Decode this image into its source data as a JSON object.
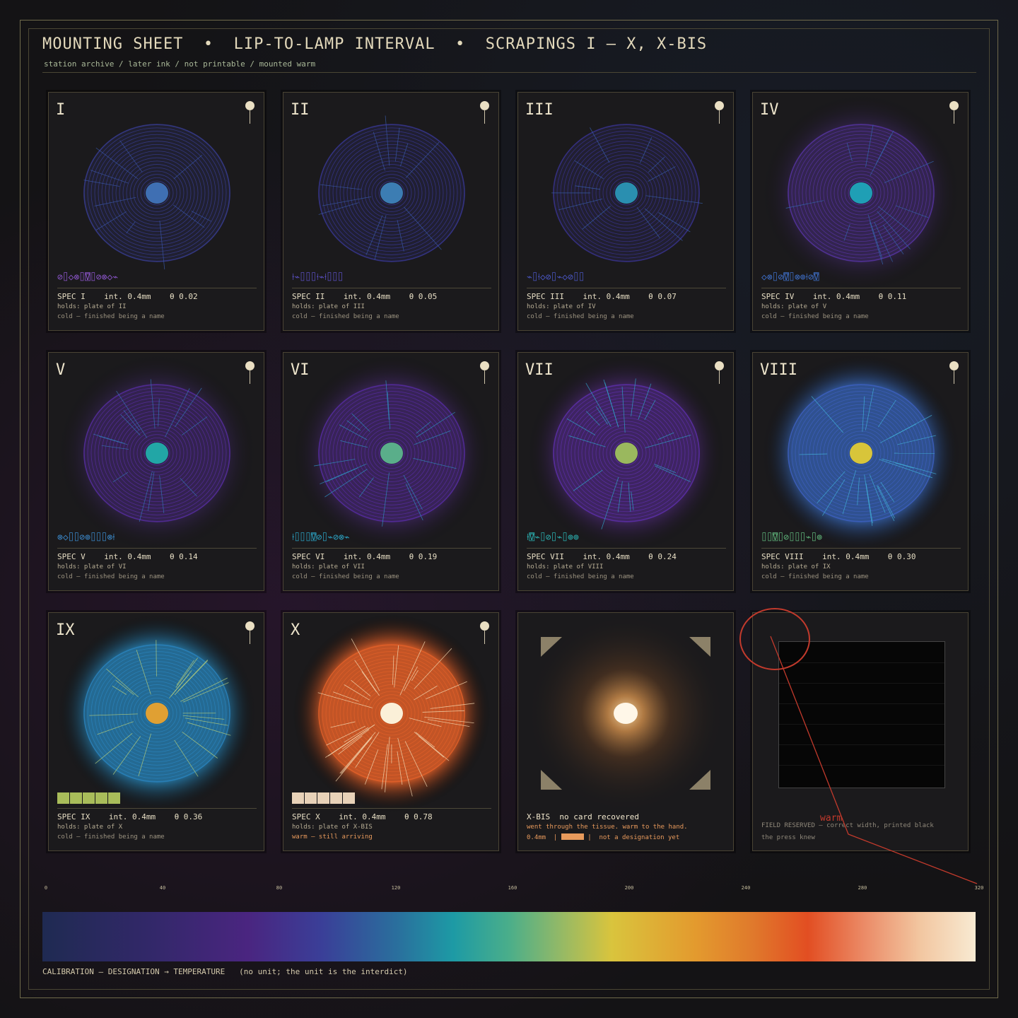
{
  "header": {
    "title": "MOUNTING SHEET  •  LIP-TO-LAMP INTERVAL  •  SCRAPINGS I — X, X-BIS",
    "subtitle": "station archive / later ink / not printable / mounted warm"
  },
  "cards": [
    {
      "numeral": "I",
      "glyphs": "⊘⌷◇⊗⌷⍔⌷⊘⊗◇⌁",
      "glyph_color": "#8b55c9",
      "spec": "SPEC I    int. 0.4mm    θ 0.02",
      "holds": "holds: plate of II",
      "state": "cold — finished being a name",
      "ring": "#3a3f98",
      "core": "#3f6fb3",
      "ray": "#3a56a8",
      "glow": "rgba(40,40,110,0.0)",
      "theta": 0.02,
      "interval_mm": 0.4
    },
    {
      "numeral": "II",
      "glyphs": "⍿⌁⌷⌷⌷⍿⌁⍿⌷⌷⌷",
      "glyph_color": "#5a4fc0",
      "spec": "SPEC II    int. 0.4mm    θ 0.05",
      "holds": "holds: plate of III",
      "state": "cold — finished being a name",
      "ring": "#3a3a9a",
      "core": "#3c7db3",
      "ray": "#3a5aa8",
      "glow": "rgba(40,40,110,0.0)",
      "theta": 0.05,
      "interval_mm": 0.4
    },
    {
      "numeral": "III",
      "glyphs": "⌁⌷⍿◇⊘⌷⌁◇⊘⌷⌷",
      "glyph_color": "#4a56c2",
      "spec": "SPEC III    int. 0.4mm    θ 0.07",
      "holds": "holds: plate of IV",
      "state": "cold — finished being a name",
      "ring": "#3b3597",
      "core": "#2a8fb0",
      "ray": "#3860ad",
      "glow": "rgba(40,40,110,0.0)",
      "theta": 0.07,
      "interval_mm": 0.4
    },
    {
      "numeral": "IV",
      "glyphs": "◇⊗⌷⊘⍔⌷⊗⊚⍿⊘⍔",
      "glyph_color": "#3e6ec6",
      "spec": "SPEC IV    int. 0.4mm    θ 0.11",
      "holds": "holds: plate of V",
      "state": "cold — finished being a name",
      "ring": "#5a35a8",
      "core": "#1f9fb5",
      "ray": "#3468b0",
      "glow": "rgba(90,50,160,0.25)",
      "theta": 0.11,
      "interval_mm": 0.4
    },
    {
      "numeral": "V",
      "glyphs": "⊗◇⌷⌷⊘⊚⌷⌷⌷⊗⍿",
      "glyph_color": "#3a86c6",
      "spec": "SPEC V    int. 0.4mm    θ 0.14",
      "holds": "holds: plate of VI",
      "state": "cold — finished being a name",
      "ring": "#5a2fa6",
      "core": "#22a6a6",
      "ray": "#3477b8",
      "glow": "rgba(90,50,160,0.25)",
      "theta": 0.14,
      "interval_mm": 0.4
    },
    {
      "numeral": "VI",
      "glyphs": "⍿⌷⌷⌷⍔⊘⌷⌁⊘⊗⌁",
      "glyph_color": "#2ba0c0",
      "spec": "SPEC VI    int. 0.4mm    θ 0.19",
      "holds": "holds: plate of VII",
      "state": "cold — finished being a name",
      "ring": "#5a2ea8",
      "core": "#5aae8a",
      "ray": "#2e92c0",
      "glow": "rgba(100,50,170,0.3)",
      "theta": 0.19,
      "interval_mm": 0.4
    },
    {
      "numeral": "VII",
      "glyphs": "⍿⍔⌁⌷⊘⌷⌁⌷⊚⊚",
      "glyph_color": "#2bb0b0",
      "spec": "SPEC VII    int. 0.4mm    θ 0.24",
      "holds": "holds: plate of VIII",
      "state": "cold — finished being a name",
      "ring": "#6030b0",
      "core": "#9ab85e",
      "ray": "#2ea6c8",
      "glow": "rgba(110,50,180,0.35)",
      "theta": 0.24,
      "interval_mm": 0.4
    },
    {
      "numeral": "VIII",
      "glyphs": "⌷⌷⍔⌷⊘⌷⌷⌷⌁⌷⊚",
      "glyph_color": "#5fb47a",
      "spec": "SPEC VIII    int. 0.4mm    θ 0.30",
      "holds": "holds: plate of IX",
      "state": "cold — finished being a name",
      "ring": "#3f62c4",
      "core": "#d8c53a",
      "ray": "#42b0d8",
      "glow": "rgba(60,120,220,0.55)",
      "theta": 0.3,
      "interval_mm": 0.4
    },
    {
      "numeral": "IX",
      "spec": "SPEC IX    int. 0.4mm    θ 0.36",
      "holds": "holds: plate of X",
      "state": "cold — finished being a name",
      "ring": "#2b86c0",
      "core": "#e0a033",
      "ray": "#b8cf7a",
      "glow": "rgba(40,150,210,0.6)",
      "theta": 0.36,
      "interval_mm": 0.4,
      "bar_color": "#a9bd5a"
    },
    {
      "numeral": "X",
      "spec": "SPEC X    int. 0.4mm    θ 0.78",
      "holds": "holds: plate of X-BIS",
      "state": "warm — still arriving",
      "ring": "#e5622a",
      "core": "#fbf0d8",
      "ray": "#f6dcb5",
      "glow": "rgba(240,100,40,0.75)",
      "theta": 0.78,
      "interval_mm": 0.4,
      "bar_color": "#e8d2b8"
    }
  ],
  "xbis": {
    "title": "X-BIS  no card recovered",
    "line1": "went through the tissue. warm to the hand.",
    "line2_a": "0.4mm  |",
    "line2_b": "|  not a designation yet",
    "swatch_color": "#e89a5c"
  },
  "reserved": {
    "label": "FIELD RESERVED — correct width, printed black",
    "note": "the press knew",
    "annotation": "warm"
  },
  "scale": {
    "ticks": [
      "0",
      "40",
      "80",
      "120",
      "160",
      "200",
      "240",
      "280",
      "320"
    ]
  },
  "calibration": "CALIBRATION — DESIGNATION → TEMPERATURE   (no unit; the unit is the interdict)",
  "colors": {
    "accent": "#d9cfb4",
    "annotation": "#c23a2c",
    "frame": "#6f6a4b"
  }
}
